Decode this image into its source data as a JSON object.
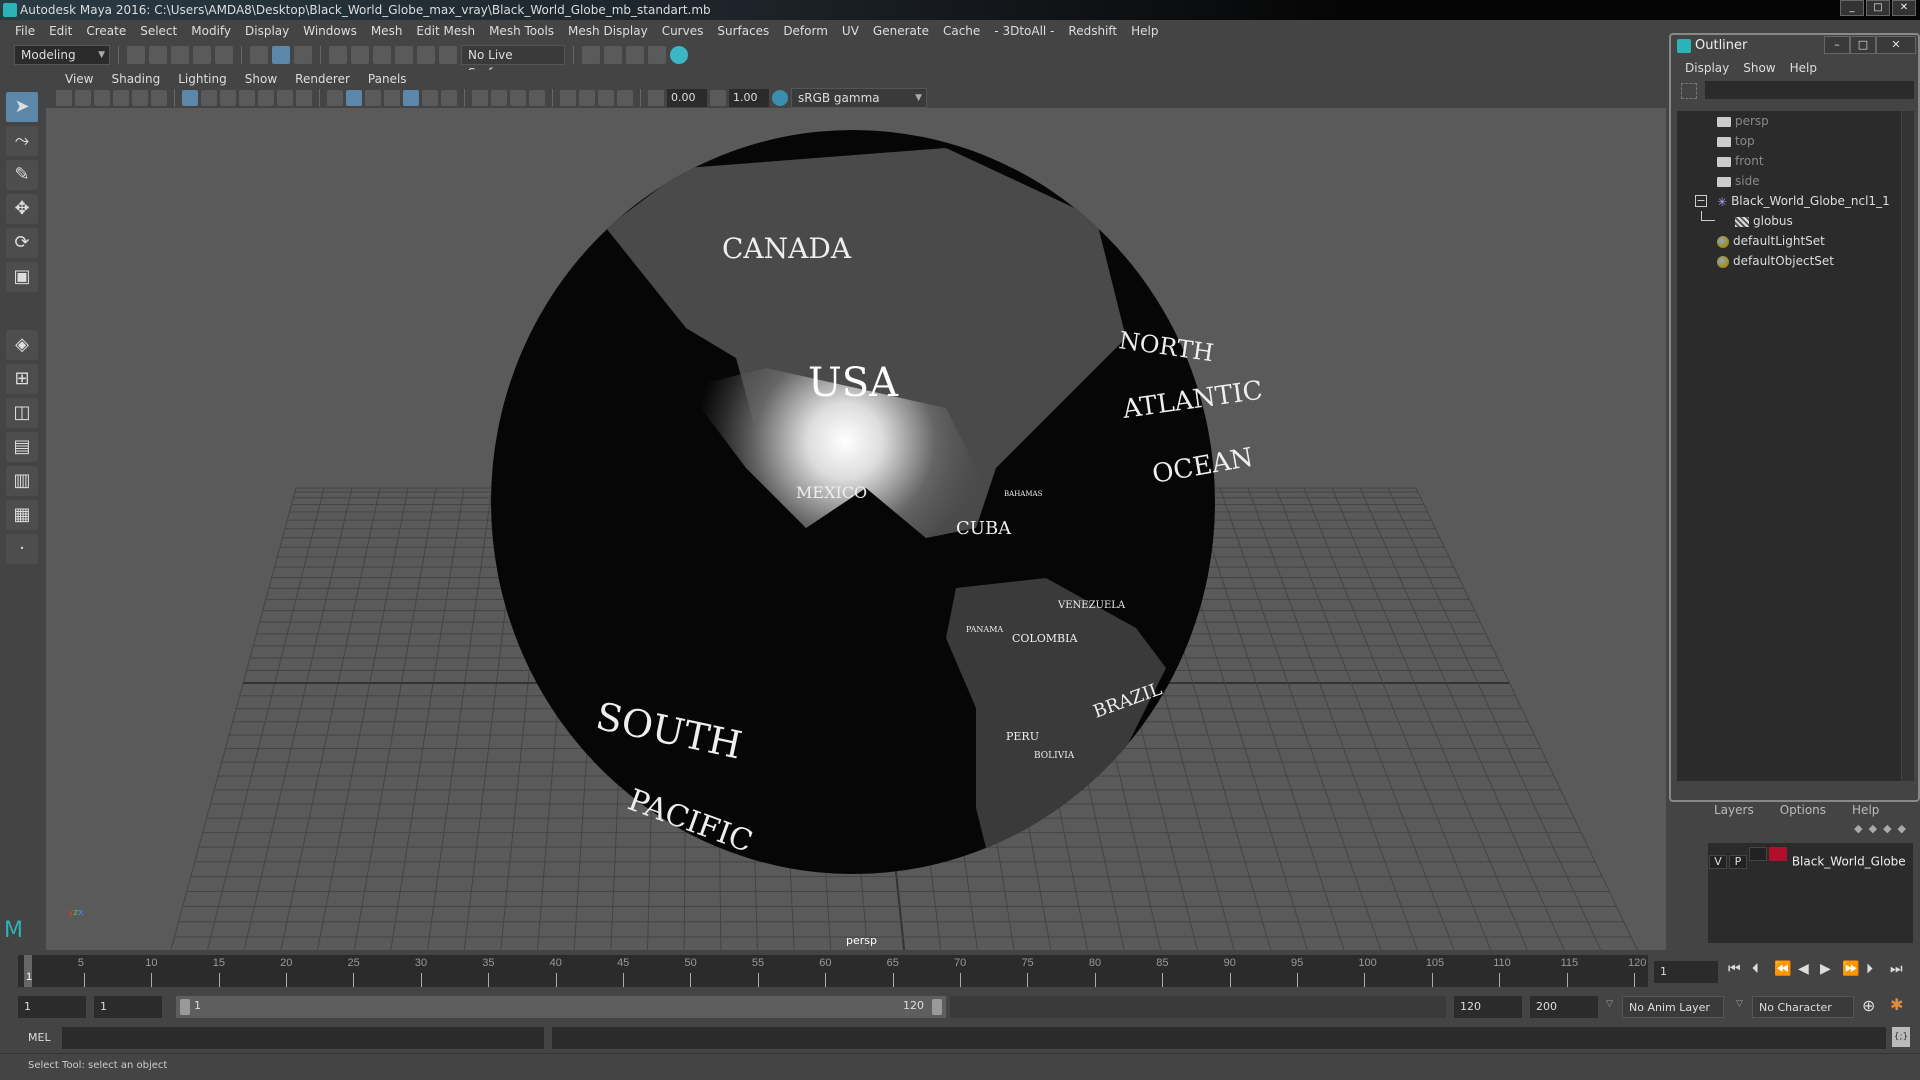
{
  "window": {
    "title": "Autodesk Maya 2016: C:\\Users\\AMDA8\\Desktop\\Black_World_Globe_max_vray\\Black_World_Globe_mb_standart.mb"
  },
  "menubar": [
    "File",
    "Edit",
    "Create",
    "Select",
    "Modify",
    "Display",
    "Windows",
    "Mesh",
    "Edit Mesh",
    "Mesh Tools",
    "Mesh Display",
    "Curves",
    "Surfaces",
    "Deform",
    "UV",
    "Generate",
    "Cache",
    "- 3DtoAll -",
    "Redshift",
    "Help"
  ],
  "shelf": {
    "mode": "Modeling",
    "live_surface": "No Live Surface"
  },
  "viewport": {
    "menu": [
      "View",
      "Shading",
      "Lighting",
      "Show",
      "Renderer",
      "Panels"
    ],
    "exposure": "0.00",
    "gamma": "1.00",
    "color_space": "sRGB gamma",
    "camera_label": "persp",
    "globe_labels": {
      "canada": "CANADA",
      "usa": "USA",
      "mexico": "MEXICO",
      "north": "NORTH",
      "atlantic": "ATLANTIC",
      "ocean": "OCEAN",
      "cuba": "CUBA",
      "venezuela": "VENEZUELA",
      "colombia": "COLOMBIA",
      "brazil": "BRAZIL",
      "peru": "PERU",
      "bolivia": "BOLIVIA",
      "south": "SOUTH",
      "pacific": "PACIFIC",
      "panama": "PANAMA",
      "bahamas": "BAHAMAS"
    }
  },
  "outliner": {
    "title": "Outliner",
    "menu": [
      "Display",
      "Show",
      "Help"
    ],
    "items": [
      {
        "label": "persp",
        "type": "camera"
      },
      {
        "label": "top",
        "type": "camera"
      },
      {
        "label": "front",
        "type": "camera"
      },
      {
        "label": "side",
        "type": "camera"
      },
      {
        "label": "Black_World_Globe_ncl1_1",
        "type": "group",
        "expanded": true
      },
      {
        "label": "globus",
        "type": "mesh"
      },
      {
        "label": "defaultLightSet",
        "type": "set"
      },
      {
        "label": "defaultObjectSet",
        "type": "set"
      }
    ]
  },
  "layers": {
    "menu": [
      "Layers",
      "Options",
      "Help"
    ],
    "layer": {
      "v": "V",
      "p": "P",
      "name": "Black_World_Globe",
      "color": "#b0102c"
    }
  },
  "timeline": {
    "ticks": [
      "5",
      "10",
      "15",
      "20",
      "25",
      "30",
      "35",
      "40",
      "45",
      "50",
      "55",
      "60",
      "65",
      "70",
      "75",
      "80",
      "85",
      "90",
      "95",
      "100",
      "105",
      "110",
      "115",
      "120"
    ],
    "current_marker": "1",
    "current_frame": "1"
  },
  "range": {
    "start": "1",
    "anim_start": "1",
    "slider_start": "1",
    "slider_end": "120",
    "end": "120",
    "anim_end": "200",
    "anim_layer": "No Anim Layer",
    "character_set": "No Character Set"
  },
  "mel": {
    "label": "MEL"
  },
  "status": {
    "text": "Select Tool: select an object"
  }
}
